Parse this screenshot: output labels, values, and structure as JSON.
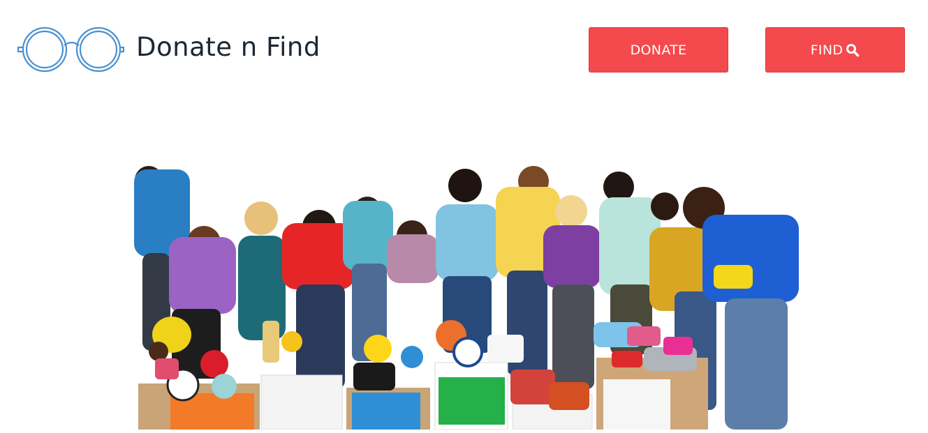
{
  "header": {
    "brand": "Donate n Find",
    "logo_icon": "glasses-icon",
    "buttons": {
      "donate_label": "DONATE",
      "find_label": "FIND",
      "find_icon": "search-icon"
    }
  },
  "colors": {
    "button_bg": "#f44a4d",
    "logo_stroke": "#4a90d0",
    "brand_text": "#1d2733"
  },
  "hero": {
    "image": "group-of-people-sorting-donation-boxes"
  }
}
